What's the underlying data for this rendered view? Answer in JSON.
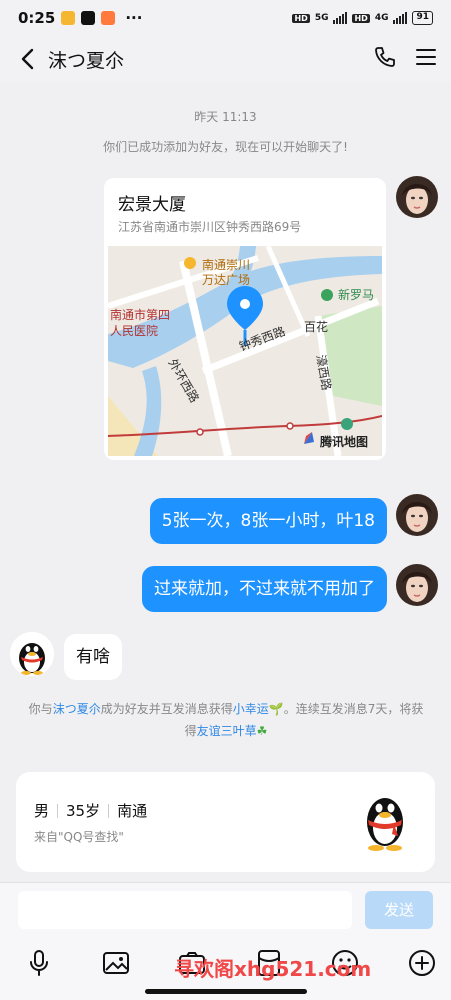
{
  "status_bar": {
    "time": "0:25",
    "dots": "···",
    "hd1": "HD",
    "net1": "5G",
    "hd2": "HD",
    "net2": "4G",
    "battery": "91"
  },
  "header": {
    "title": "沫つ夏尒"
  },
  "chat": {
    "timestamp": "昨天 11:13",
    "added_notice": "你们已成功添加为好友，现在可以开始聊天了!",
    "location": {
      "name": "宏景大厦",
      "address": "江苏省南通市崇川区钟秀西路69号",
      "map_labels": {
        "poi_wanda": "南通崇川",
        "poi_wanda_2": "万达广场",
        "poi_hospital": "南通市第四",
        "poi_hospital_2": "人民医院",
        "poi_luoma": "新罗马",
        "road_zhongxiu": "钟秀西路",
        "road_baihua": "百花",
        "road_waihuan": "外环西路",
        "road_haoxi": "濠西路",
        "brand": "腾讯地图"
      }
    },
    "messages": [
      {
        "text": "5张一次，8张一小时，叶18"
      },
      {
        "text": "过来就加，不过来就不用加了"
      },
      {
        "text": "有啥"
      }
    ],
    "system": {
      "p1": "你与",
      "name": "沫つ夏尒",
      "p2": "成为好友并互发消息获得",
      "luck": "小幸运",
      "p3": "。连续互发消息7天，将获得",
      "clover": "友谊三叶草"
    },
    "profile": {
      "gender": "男",
      "age": "35岁",
      "city": "南通",
      "source": "来自\"QQ号查找\""
    }
  },
  "input": {
    "placeholder": "",
    "send_label": "发送"
  },
  "watermark": "寻欢阁xhg521.com",
  "colors": {
    "accent": "#1e92ff",
    "link": "#2f88e5"
  }
}
